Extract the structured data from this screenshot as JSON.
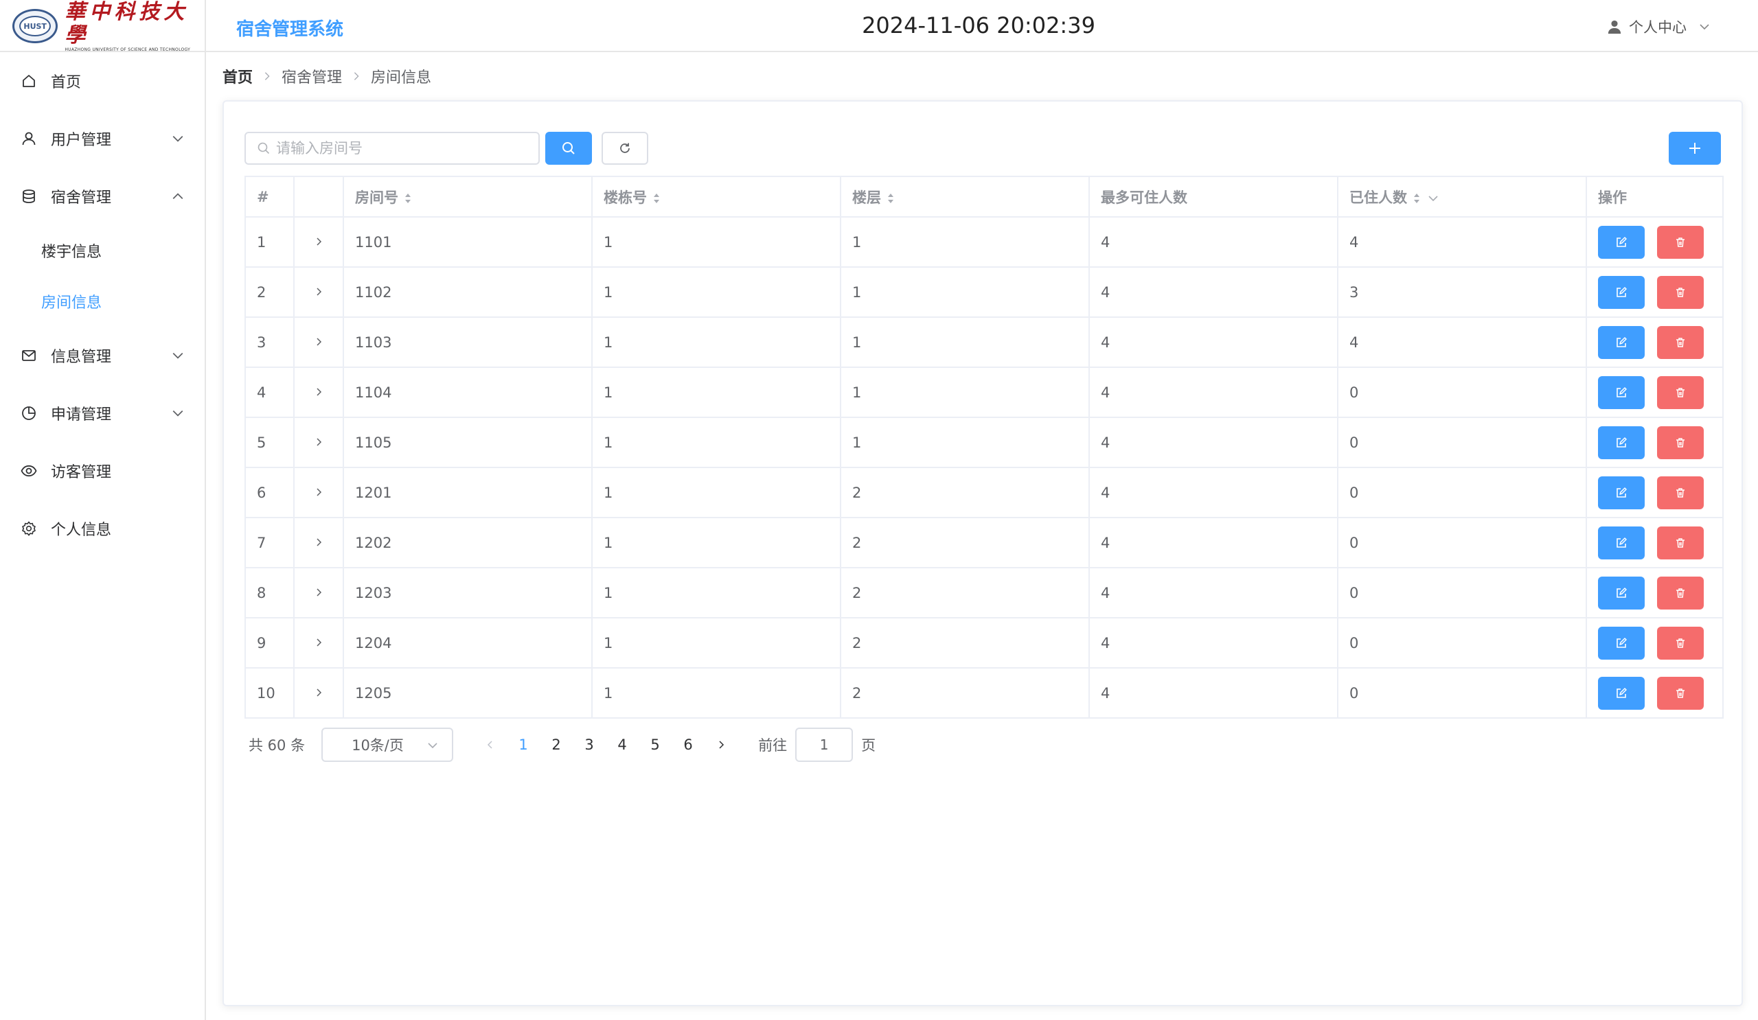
{
  "header": {
    "logo_cn": "華中科技大學",
    "logo_en": "HUAZHONG UNIVERSITY OF SCIENCE AND TECHNOLOGY",
    "logo_emblem": "HUST",
    "app_title": "宿舍管理系统",
    "datetime": "2024-11-06 20:02:39",
    "user_center": "个人中心"
  },
  "sidebar": {
    "items": [
      {
        "label": "首页",
        "icon": "home-icon"
      },
      {
        "label": "用户管理",
        "icon": "user-icon",
        "expandable": true,
        "expanded": false
      },
      {
        "label": "宿舍管理",
        "icon": "database-icon",
        "expandable": true,
        "expanded": true
      },
      {
        "label": "信息管理",
        "icon": "message-icon",
        "expandable": true,
        "expanded": false
      },
      {
        "label": "申请管理",
        "icon": "pie-chart-icon",
        "expandable": true,
        "expanded": false
      },
      {
        "label": "访客管理",
        "icon": "eye-icon"
      },
      {
        "label": "个人信息",
        "icon": "setting-icon"
      }
    ],
    "subitems": [
      {
        "label": "楼宇信息",
        "active": false
      },
      {
        "label": "房间信息",
        "active": true
      }
    ]
  },
  "breadcrumb": [
    "首页",
    "宿舍管理",
    "房间信息"
  ],
  "search": {
    "placeholder": "请输入房间号",
    "value": ""
  },
  "table": {
    "columns": [
      "#",
      "",
      "房间号",
      "楼栋号",
      "楼层",
      "最多可住人数",
      "已住人数",
      "操作"
    ],
    "rows": [
      {
        "idx": "1",
        "room": "1101",
        "building": "1",
        "floor": "1",
        "max": "4",
        "occupied": "4"
      },
      {
        "idx": "2",
        "room": "1102",
        "building": "1",
        "floor": "1",
        "max": "4",
        "occupied": "3"
      },
      {
        "idx": "3",
        "room": "1103",
        "building": "1",
        "floor": "1",
        "max": "4",
        "occupied": "4"
      },
      {
        "idx": "4",
        "room": "1104",
        "building": "1",
        "floor": "1",
        "max": "4",
        "occupied": "0"
      },
      {
        "idx": "5",
        "room": "1105",
        "building": "1",
        "floor": "1",
        "max": "4",
        "occupied": "0"
      },
      {
        "idx": "6",
        "room": "1201",
        "building": "1",
        "floor": "2",
        "max": "4",
        "occupied": "0"
      },
      {
        "idx": "7",
        "room": "1202",
        "building": "1",
        "floor": "2",
        "max": "4",
        "occupied": "0"
      },
      {
        "idx": "8",
        "room": "1203",
        "building": "1",
        "floor": "2",
        "max": "4",
        "occupied": "0"
      },
      {
        "idx": "9",
        "room": "1204",
        "building": "1",
        "floor": "2",
        "max": "4",
        "occupied": "0"
      },
      {
        "idx": "10",
        "room": "1205",
        "building": "1",
        "floor": "2",
        "max": "4",
        "occupied": "0"
      }
    ]
  },
  "pagination": {
    "total": "共 60 条",
    "page_size": "10条/页",
    "pages": [
      "1",
      "2",
      "3",
      "4",
      "5",
      "6"
    ],
    "current": "1",
    "goto_label": "前往",
    "goto_value": "1",
    "page_unit": "页"
  },
  "colors": {
    "primary": "#409eff",
    "danger": "#f56c6c",
    "brand_red": "#b3191f"
  }
}
